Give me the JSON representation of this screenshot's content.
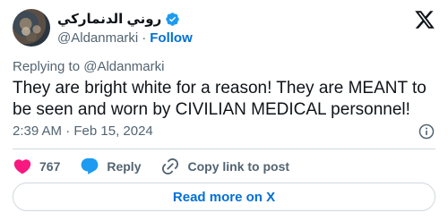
{
  "author": {
    "display_name": "روني الدنماركي",
    "handle": "@Aldanmarki",
    "separator": "·",
    "follow_label": "Follow",
    "verified_color": "#1d9bf0"
  },
  "icons": {
    "avatar": "profile-photo",
    "verified": "verified-badge-icon",
    "logo": "x-logo-icon",
    "info": "info-icon",
    "like": "heart-icon",
    "reply": "speech-bubble-icon",
    "copy": "link-icon"
  },
  "reply_context": {
    "prefix": "Replying to",
    "mention": "@Aldanmarki"
  },
  "tweet": {
    "text": "They are bright white for a reason! They are MEANT to be seen and worn by CIVILIAN MEDICAL personnel!",
    "timestamp": "2:39 AM · Feb 15, 2024"
  },
  "actions": {
    "like_count": "767",
    "reply_label": "Reply",
    "copy_label": "Copy link to post"
  },
  "footer": {
    "read_more_label": "Read more on X"
  },
  "colors": {
    "accent": "#006fd6",
    "like": "#f91880",
    "reply": "#1d9bf0",
    "muted": "#536471",
    "text": "#0f1419"
  }
}
